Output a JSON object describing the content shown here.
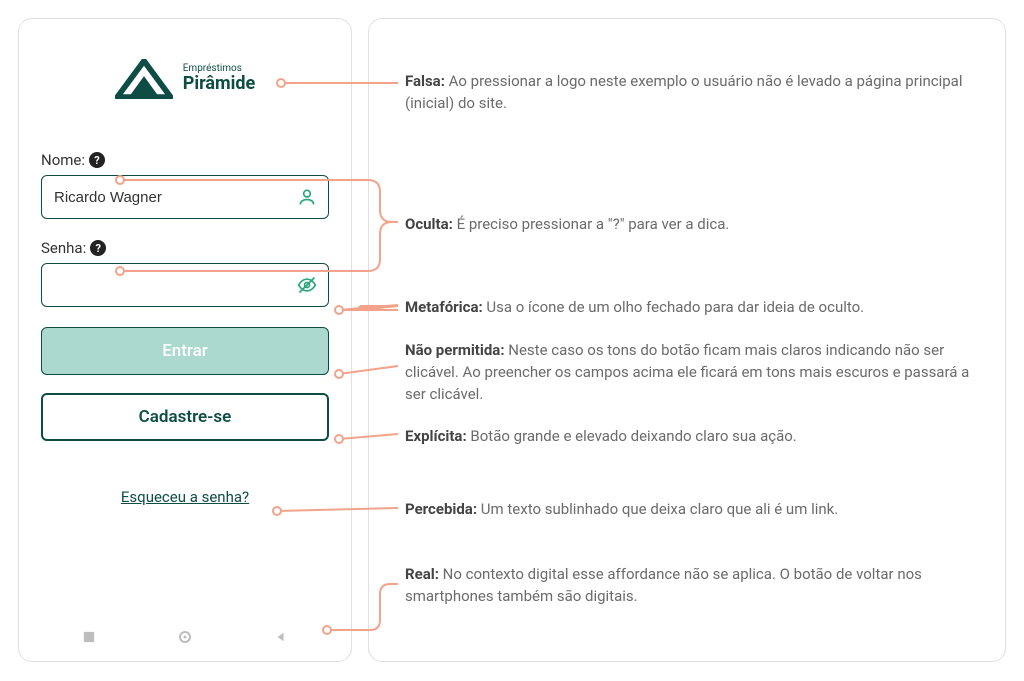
{
  "logo": {
    "small": "Empréstimos",
    "big": "Pirâmide"
  },
  "form": {
    "name_label": "Nome:",
    "name_value": "Ricardo Wagner",
    "password_label": "Senha:",
    "password_value": "",
    "login_button": "Entrar",
    "signup_button": "Cadastre-se",
    "forgot_link": "Esqueceu a senha?"
  },
  "annotations": {
    "falsa": {
      "title": "Falsa:",
      "text": " Ao pressionar a logo neste exemplo o usuário não é levado a página principal (inicial) do site."
    },
    "oculta": {
      "title": "Oculta:",
      "text": " É preciso pressionar a \"?\" para ver a dica."
    },
    "metaforica": {
      "title": "Metafórica:",
      "text": " Usa o ícone de um olho fechado para dar ideia de oculto."
    },
    "nao_permitida": {
      "title": "Não permitida:",
      "text": " Neste caso os tons do botão ficam mais claros indicando não ser clicável. Ao preencher os campos acima ele ficará em tons mais escuros e passará a ser clicável."
    },
    "explicita": {
      "title": "Explícita:",
      "text": " Botão grande e elevado deixando claro sua ação."
    },
    "percebida": {
      "title": "Percebida:",
      "text": " Um texto sublinhado que deixa claro que ali é um link."
    },
    "real": {
      "title": "Real:",
      "text": " No contexto digital esse affordance não se aplica. O botão de voltar nos smartphones também são digitais."
    }
  }
}
